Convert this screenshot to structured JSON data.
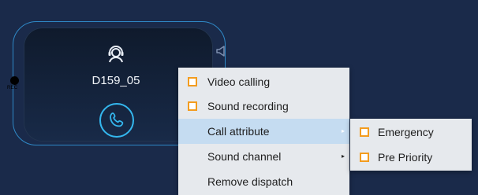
{
  "device": {
    "name": "D159_05",
    "rec_label": "REC",
    "colors": {
      "background": "#1a2a4a",
      "card": "#121f35",
      "accent": "#34b7ee"
    }
  },
  "context_menu": {
    "items": [
      {
        "label": "Video calling",
        "checkbox": true
      },
      {
        "label": "Sound recording",
        "checkbox": true
      },
      {
        "label": "Call attribute",
        "submenu": true,
        "highlighted": true
      },
      {
        "label": "Sound channel",
        "submenu": true
      },
      {
        "label": "Remove dispatch"
      }
    ],
    "arrow_glyph": "▸"
  },
  "submenu": {
    "items": [
      {
        "label": "Emergency",
        "checkbox": true
      },
      {
        "label": "Pre Priority",
        "checkbox": true
      }
    ]
  },
  "icons": {
    "user": "operator-headset-icon",
    "call": "phone-icon",
    "speaker": "speaker-icon",
    "checkbox": "checkbox-unchecked-icon"
  }
}
